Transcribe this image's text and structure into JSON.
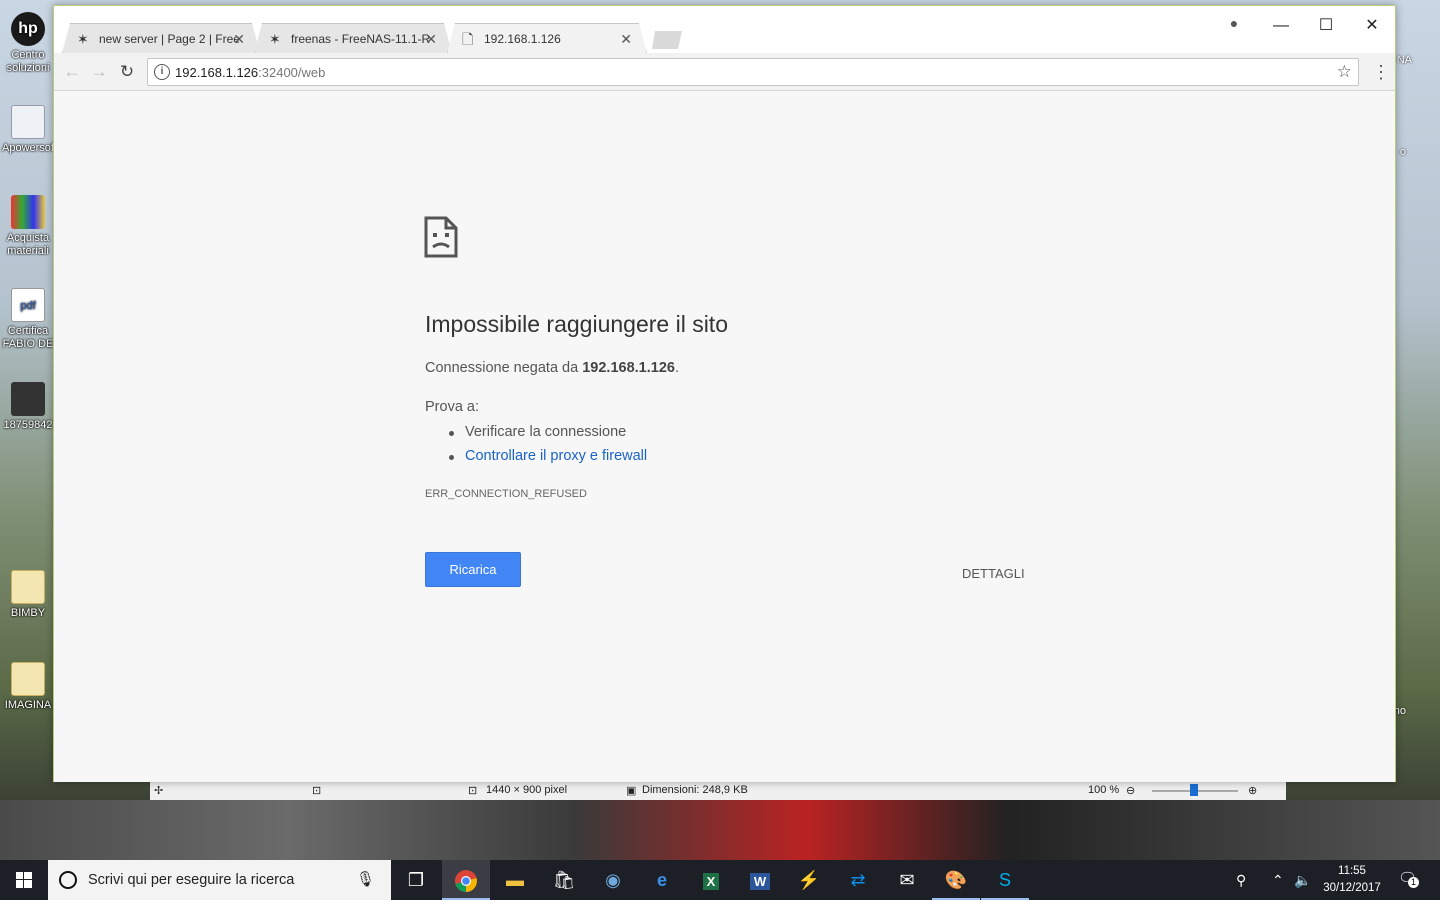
{
  "desktop": {
    "icons_left": [
      {
        "label": "Centro soluzioni"
      },
      {
        "label": "Apowersof"
      },
      {
        "label": "Acquista materiali"
      },
      {
        "label": "Certifica FABIO DE"
      },
      {
        "label": "18759842"
      },
      {
        "label": "BIMBY"
      },
      {
        "label": "IMAGINA"
      }
    ],
    "icons_right": [
      {
        "label": "NA"
      },
      {
        "label": "o"
      },
      {
        "label": "no"
      }
    ]
  },
  "viewer_status": {
    "dimensions": "1440 × 900 pixel",
    "size": "Dimensioni: 248,9 KB",
    "zoom": "100 %"
  },
  "browser": {
    "tabs": [
      {
        "title": "new server | Page 2 | Free",
        "icon": "freenas-icon",
        "active": false
      },
      {
        "title": "freenas - FreeNAS-11.1-R",
        "icon": "freenas-icon",
        "active": false
      },
      {
        "title": "192.168.1.126",
        "icon": "page-icon",
        "active": true
      }
    ],
    "address": {
      "host": "192.168.1.126",
      "path": ":32400/web"
    }
  },
  "error_page": {
    "title": "Impossibile raggiungere il sito",
    "subtitle_prefix": "Connessione negata da ",
    "subtitle_host": "192.168.1.126",
    "subtitle_suffix": ".",
    "try_label": "Prova a:",
    "suggestions": [
      {
        "text": "Verificare la connessione",
        "link": false
      },
      {
        "text": "Controllare il proxy e firewall",
        "link": true
      }
    ],
    "error_code": "ERR_CONNECTION_REFUSED",
    "reload_label": "Ricarica",
    "details_label": "DETTAGLI"
  },
  "taskbar": {
    "search_placeholder": "Scrivi qui per eseguire la ricerca",
    "apps": [
      "task-view",
      "chrome",
      "file-explorer",
      "store",
      "thunderbird",
      "edge",
      "excel",
      "word",
      "winamp",
      "teamviewer",
      "mail",
      "paint",
      "skype"
    ],
    "clock_time": "11:55",
    "clock_date": "30/12/2017",
    "notification_count": "1"
  },
  "colors": {
    "accent": "#4285f4",
    "link": "#1a62c7",
    "window_border": "#b5cc7a",
    "taskbar": "#1c1f26"
  }
}
